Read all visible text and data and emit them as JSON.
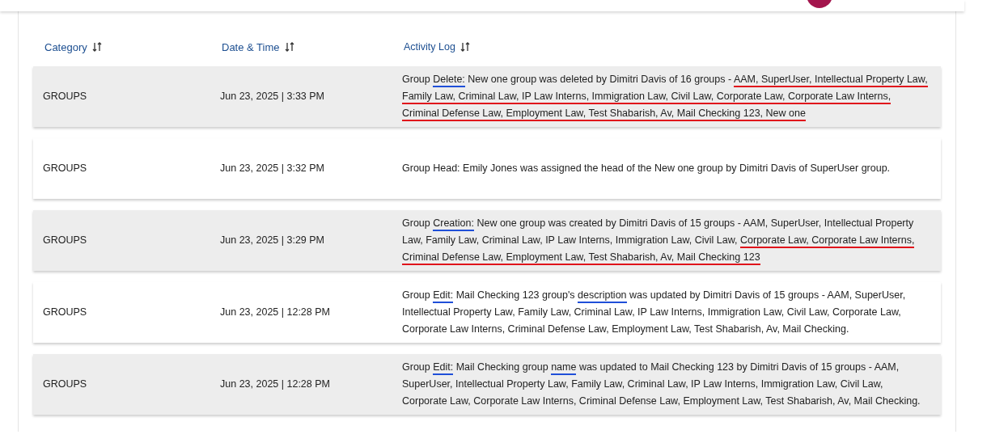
{
  "columns": [
    {
      "label": "Category"
    },
    {
      "label": "Date & Time"
    },
    {
      "label": "Activity Log"
    }
  ],
  "rows": [
    {
      "category": "GROUPS",
      "datetime": "Jun 23, 2025 | 3:33 PM",
      "log": [
        {
          "text": "Group "
        },
        {
          "text": "Delete:",
          "color": "#1f4fd8"
        },
        {
          "text": " New one group was deleted by Dimitri Davis of 16 groups - "
        },
        {
          "text": "AAM, SuperUser, Intellectual Property Law, Family Law, Criminal Law, IP Law Interns, Immigration Law, Civil Law, Corporate Law, Corporate Law Interns, Criminal Defense Law, Employment Law, Test Shabarish, Av, Mail Checking 123, New one",
          "color": "#e0141b"
        }
      ]
    },
    {
      "category": "GROUPS",
      "datetime": "Jun 23, 2025 | 3:32 PM",
      "log": [
        {
          "text": "Group Head: Emily Jones was assigned the head of the New one group by Dimitri Davis of SuperUser group."
        }
      ]
    },
    {
      "category": "GROUPS",
      "datetime": "Jun 23, 2025 | 3:29 PM",
      "log": [
        {
          "text": "Group "
        },
        {
          "text": "Creation:",
          "color": "#1f4fd8"
        },
        {
          "text": " New one group was created by Dimitri Davis of 15 groups - AAM, SuperUser, Intellectual Property Law, Family Law, Criminal Law, IP Law Interns, Immigration Law, Civil Law, "
        },
        {
          "text": "Corporate Law, Corporate Law Interns, Criminal Defense Law, Employment Law, Test Shabarish, Av, Mail Checking 123",
          "color": "#e0141b"
        }
      ]
    },
    {
      "category": "GROUPS",
      "datetime": "Jun 23, 2025 | 12:28 PM",
      "log": [
        {
          "text": "Group "
        },
        {
          "text": "Edit:",
          "color": "#1f4fd8"
        },
        {
          "text": " Mail Checking 123 group's "
        },
        {
          "text": "description",
          "color": "#1f4fd8"
        },
        {
          "text": " was updated by Dimitri Davis of 15 groups - AAM, SuperUser, Intellectual Property Law, Family Law, Criminal Law, IP Law Interns, Immigration Law, Civil Law, Corporate Law, Corporate Law Interns, Criminal Defense Law, Employment Law, Test Shabarish, Av, Mail Checking."
        }
      ]
    },
    {
      "category": "GROUPS",
      "datetime": "Jun 23, 2025 | 12:28 PM",
      "log": [
        {
          "text": "Group "
        },
        {
          "text": "Edit:",
          "color": "#1f4fd8"
        },
        {
          "text": " Mail Checking group "
        },
        {
          "text": "name",
          "color": "#1f4fd8"
        },
        {
          "text": " was updated to Mail Checking 123 by Dimitri Davis of 15 groups - AAM, SuperUser, Intellectual Property Law, Family Law, Criminal Law, IP Law Interns, Immigration Law, Civil Law, Corporate Law, Corporate Law Interns, Criminal Defense Law, Employment Law, Test Shabarish, Av, Mail Checking."
        }
      ]
    }
  ]
}
